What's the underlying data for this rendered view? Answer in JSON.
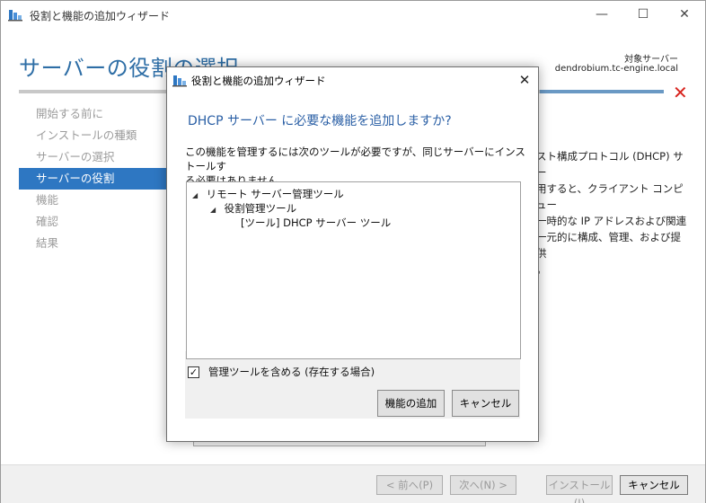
{
  "window": {
    "title": "役割と機能の追加ウィザード",
    "controls": {
      "minimize": "—",
      "maximize": "☐",
      "close": "✕"
    }
  },
  "header": {
    "title": "サーバーの役割の選択",
    "target_server_label": "対象サーバー",
    "target_server_name": "dendrobium.tc-engine.local",
    "error_icon": "✕"
  },
  "nav": {
    "items": [
      {
        "label": "開始する前に",
        "active": false
      },
      {
        "label": "インストールの種類",
        "active": false
      },
      {
        "label": "サーバーの選択",
        "active": false
      },
      {
        "label": "サーバーの役割",
        "active": true
      },
      {
        "label": "機能",
        "active": false
      },
      {
        "label": "確認",
        "active": false
      },
      {
        "label": "結果",
        "active": false
      }
    ]
  },
  "description": {
    "lines": [
      "スト構成プロトコル (DHCP) サー",
      "用すると、クライアント コンピュー",
      "一時的な IP アドレスおよび関連",
      "一元的に構成、管理、および提供",
      "。"
    ]
  },
  "footer": {
    "prev_label": "< 前へ(P)",
    "next_label": "次へ(N) >",
    "install_label": "インストール(I)",
    "cancel_label": "キャンセル"
  },
  "dialog": {
    "title": "役割と機能の追加ウィザード",
    "close": "✕",
    "heading": "DHCP サーバー に必要な機能を追加しますか?",
    "body_line1": "この機能を管理するには次のツールが必要ですが、同じサーバーにインストールす",
    "body_line2": "る必要はありません。",
    "tree": [
      {
        "label": "リモート サーバー管理ツール",
        "arrow": "◢"
      },
      {
        "label": "役割管理ツール",
        "arrow": "◢"
      },
      {
        "label": "[ツール] DHCP サーバー ツール",
        "arrow": ""
      }
    ],
    "checkbox": {
      "label": "管理ツールを含める (存在する場合)",
      "checked": true,
      "mark": "✓"
    },
    "add_label": "機能の追加",
    "cancel_label": "キャンセル"
  }
}
